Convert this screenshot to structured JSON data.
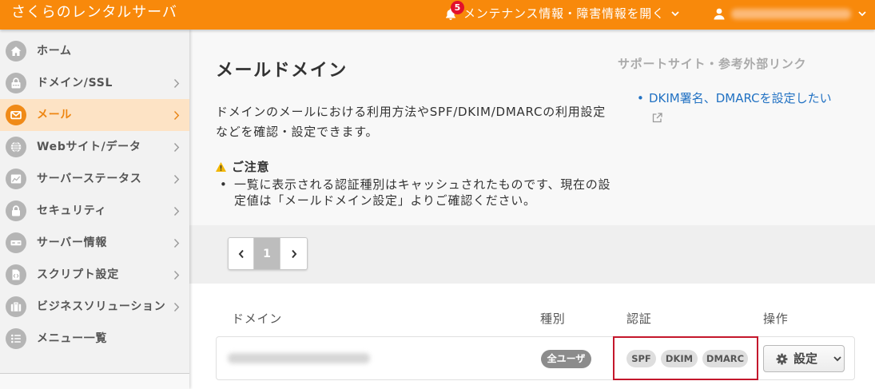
{
  "header": {
    "app_title": "さくらのレンタルサーバ",
    "notification_count": "5",
    "maintenance_label": "メンテナンス情報・障害情報を開く",
    "icons": {
      "notification": "bell-icon",
      "maintenance_toggle": "chevron-down-icon",
      "user": "user-icon",
      "user_toggle": "chevron-down-icon"
    }
  },
  "sidebar": {
    "items": [
      {
        "label": "ホーム",
        "icon": "home-icon",
        "active": false,
        "has_submenu": false
      },
      {
        "label": "ドメイン/SSL",
        "icon": "domain-ssl-icon",
        "active": false,
        "has_submenu": true
      },
      {
        "label": "メール",
        "icon": "mail-icon",
        "active": true,
        "has_submenu": true
      },
      {
        "label": "Webサイト/データ",
        "icon": "globe-icon",
        "active": false,
        "has_submenu": true
      },
      {
        "label": "サーバーステータス",
        "icon": "chart-icon",
        "active": false,
        "has_submenu": true
      },
      {
        "label": "セキュリティ",
        "icon": "lock-icon",
        "active": false,
        "has_submenu": true
      },
      {
        "label": "サーバー情報",
        "icon": "server-icon",
        "active": false,
        "has_submenu": true
      },
      {
        "label": "スクリプト設定",
        "icon": "script-icon",
        "active": false,
        "has_submenu": true
      },
      {
        "label": "ビジネスソリューション",
        "icon": "briefcase-icon",
        "active": false,
        "has_submenu": true
      },
      {
        "label": "メニュー一覧",
        "icon": "list-icon",
        "active": false,
        "has_submenu": false
      }
    ]
  },
  "main": {
    "title": "メールドメイン",
    "description": "ドメインのメールにおける利用方法やSPF/DKIM/DMARCの利用設定などを確認・設定できます。",
    "notice": {
      "icon": "warning-icon",
      "heading": "ご注意",
      "items": [
        "一覧に表示される認証種別はキャッシュされたものです、現在の設定値は「メールドメイン設定」よりご確認ください。"
      ]
    },
    "support": {
      "heading": "サポートサイト・参考外部リンク",
      "links": [
        {
          "label": "DKIM署名、DMARCを設定したい",
          "icon": "external-link-icon"
        }
      ]
    },
    "pagination": {
      "prev_icon": "chevron-left-icon",
      "current_page": "1",
      "next_icon": "chevron-right-icon"
    },
    "table": {
      "columns": {
        "domain": "ドメイン",
        "type": "種別",
        "auth": "認証",
        "actions": "操作"
      },
      "rows": [
        {
          "type": "全ユーザ",
          "auth": [
            "SPF",
            "DKIM",
            "DMARC"
          ],
          "action_label": "設定",
          "action_icon": "gear-icon"
        }
      ]
    }
  },
  "colors": {
    "brand": "#f8890b",
    "active_item_bg": "#fde3c5",
    "active_item_text": "#ee8612",
    "link": "#2272c3",
    "notification_badge": "#e2112c",
    "auth_highlight_border": "#c4172c"
  }
}
